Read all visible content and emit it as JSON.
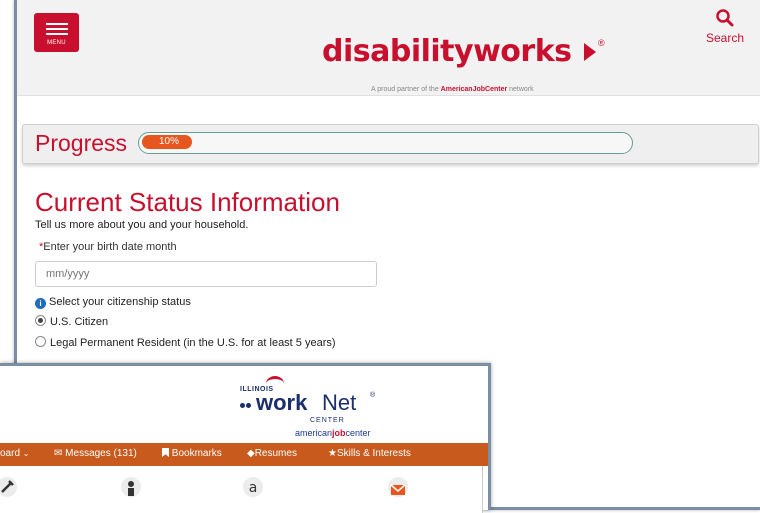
{
  "header": {
    "menu_label": "MENU",
    "logo_part1": "disability",
    "logo_part2": "works",
    "partner_prefix": "A proud partner of the ",
    "partner_brand": "AmericanJobCenter",
    "partner_suffix": " network",
    "search_label": "Search",
    "brand_color": "#c8102e"
  },
  "progress": {
    "title": "Progress",
    "percent_label": "10%",
    "value": 0.1
  },
  "status_form": {
    "title": "Current Status Information",
    "subtitle": "Tell us more about you and your household.",
    "birth_label_req": "*",
    "birth_label": "Enter your birth date month",
    "birth_placeholder": "mm/yyyy",
    "citizenship_label": "Select your citizenship status",
    "options": [
      {
        "label": "U.S. Citizen",
        "selected": true
      },
      {
        "label": "Legal Permanent Resident (in the U.S. for at least 5 years)",
        "selected": false
      }
    ]
  },
  "workforce": {
    "illinois": "ILLINOIS",
    "work": "work",
    "net": "Net",
    "reg": "®",
    "center": "CENTER",
    "ajc_1": "american",
    "ajc_2": "job",
    "ajc_3": "center",
    "nav": {
      "dashboard": "oard",
      "messages": "Messages (131)",
      "bookmarks": "Bookmarks",
      "resumes": "Resumes",
      "skills": "Skills & Interests"
    },
    "nav_color": "#c85a1d",
    "content_icons": [
      "tools-icon",
      "person-icon",
      "certificate-icon",
      "envelope-icon"
    ]
  }
}
